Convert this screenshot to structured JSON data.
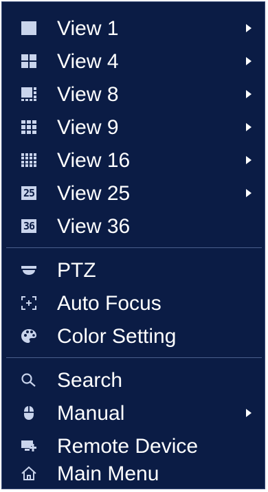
{
  "menu": {
    "items": [
      {
        "label": "View 1",
        "icon": "view-1-icon",
        "submenu": true
      },
      {
        "label": "View 4",
        "icon": "view-4-icon",
        "submenu": true
      },
      {
        "label": "View 8",
        "icon": "view-8-icon",
        "submenu": true
      },
      {
        "label": "View 9",
        "icon": "view-9-icon",
        "submenu": true
      },
      {
        "label": "View 16",
        "icon": "view-16-icon",
        "submenu": true
      },
      {
        "label": "View 25",
        "icon": "view-25-icon",
        "badge": "25",
        "submenu": true
      },
      {
        "label": "View 36",
        "icon": "view-36-icon",
        "badge": "36",
        "submenu": false
      },
      {
        "label": "PTZ",
        "icon": "ptz-camera-icon",
        "submenu": false
      },
      {
        "label": "Auto Focus",
        "icon": "auto-focus-icon",
        "submenu": false
      },
      {
        "label": "Color Setting",
        "icon": "palette-icon",
        "submenu": false
      },
      {
        "label": "Search",
        "icon": "search-icon",
        "submenu": false
      },
      {
        "label": "Manual",
        "icon": "mouse-icon",
        "submenu": true
      },
      {
        "label": "Remote Device",
        "icon": "remote-device-icon",
        "submenu": false
      },
      {
        "label": "Main Menu",
        "icon": "home-icon",
        "submenu": false
      }
    ]
  },
  "colors": {
    "background": "#0b1c45",
    "text": "#ffffff",
    "icon": "#c9d4ec",
    "separator": "#4a5f8c"
  }
}
